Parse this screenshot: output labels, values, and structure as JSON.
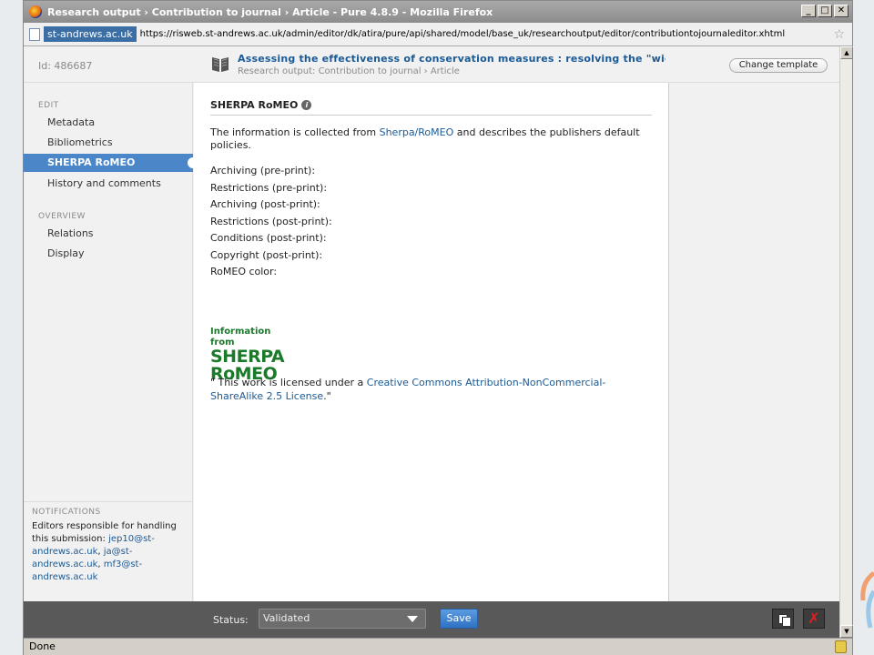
{
  "browser": {
    "window_title": "Research output › Contribution to journal › Article - Pure 4.8.9 - Mozilla Firefox",
    "site_badge": "st-andrews.ac.uk",
    "url": "https://risweb.st-andrews.ac.uk/admin/editor/dk/atira/pure/api/shared/model/base_uk/researchoutput/editor/contributiontojournaleditor.xhtml",
    "status_text": "Done"
  },
  "header": {
    "id_label": "Id: 486687",
    "title": "Assessing the effectiveness of conservation measures : resolving the \"wick",
    "subtitle": "Research output: Contribution to journal › Article",
    "change_template_label": "Change template"
  },
  "sidebar": {
    "edit_section": "EDIT",
    "edit_items": [
      {
        "label": "Metadata"
      },
      {
        "label": "Bibliometrics"
      },
      {
        "label": "SHERPA RoMEO",
        "active": true
      },
      {
        "label": "History and comments"
      }
    ],
    "overview_section": "OVERVIEW",
    "overview_items": [
      {
        "label": "Relations"
      },
      {
        "label": "Display"
      }
    ]
  },
  "notifications": {
    "title": "NOTIFICATIONS",
    "text": "Editors responsible for handling this submission:",
    "emails": [
      "jep10@st-andrews.ac.uk",
      "ja@st-andrews.ac.uk",
      "mf3@st-andrews.ac.uk"
    ]
  },
  "content": {
    "heading": "SHERPA RoMEO",
    "desc_prefix": "The information is collected from ",
    "desc_link": "Sherpa/RoMEO",
    "desc_suffix": " and describes the publishers default policies.",
    "fields": [
      "Archiving (pre-print):",
      "Restrictions (pre-print):",
      "Archiving (post-print):",
      "Restrictions (post-print):",
      "Conditions (post-print):",
      "Copyright (post-print):",
      "RoMEO color:"
    ],
    "logo_line1": "Information from",
    "logo_line2": "SHERPA",
    "logo_line3": "RoMEO",
    "license_prefix": "\" This work is licensed under a ",
    "license_link": "Creative Commons Attribution-NonCommercial-ShareAlike 2.5 License",
    "license_suffix": ".\""
  },
  "footer": {
    "status_label": "Status:",
    "status_value": "Validated",
    "save_label": "Save"
  },
  "colors": {
    "accent": "#4a86c8",
    "link": "#1a5a96",
    "footer_bg": "#595959",
    "logo_green": "#1a7a2a"
  }
}
